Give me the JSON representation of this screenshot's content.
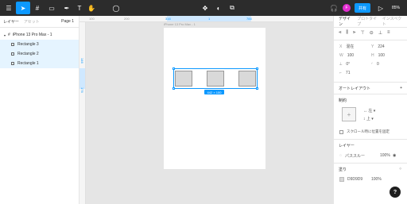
{
  "toolbar": {
    "share_label": "共有",
    "zoom_label": "85%",
    "avatar_letter": "F",
    "accent": "#0d99ff"
  },
  "left_panel": {
    "tab_layers": "レイヤー",
    "tab_assets": "アセット",
    "page_label": "Page 1",
    "frame_name": "iPhone 13 Pro Max - 1",
    "layers": [
      "Rectangle 3",
      "Rectangle 2",
      "Rectangle 1"
    ]
  },
  "ruler": {
    "top_marks": [
      "100",
      "200",
      "316",
      "784"
    ],
    "top_highlight_left": "316",
    "top_highlight_mid": "1",
    "top_highlight_right": "784",
    "left_marks": [
      "146",
      "176"
    ]
  },
  "canvas": {
    "frame_label": "iPhone 13 Pro Max - 1",
    "size_badge": "442 × 100"
  },
  "right_panel": {
    "tab_design": "デザイン",
    "tab_prototype": "プロトタイプ",
    "tab_inspect": "インスペクト",
    "x_label": "X",
    "x_value": "混在",
    "y_label": "Y",
    "y_value": "224",
    "w_label": "W",
    "w_value": "100",
    "h_label": "H",
    "h_value": "100",
    "r_label": "⟂",
    "r_value": "0°",
    "c_label": "◜",
    "c_value": "0",
    "clip_value": "71",
    "auto_layout_title": "オートレイアウト",
    "constraints_title": "制約",
    "constraint_h": "左",
    "constraint_v": "上",
    "scroll_label": "スクロール時に位置を固定",
    "layer_title": "レイヤー",
    "blend_label": "パススルー",
    "opacity_value": "100%",
    "fill_title": "塗り",
    "fill_hex": "D9D9D9",
    "fill_opacity": "100%"
  },
  "help": "?"
}
